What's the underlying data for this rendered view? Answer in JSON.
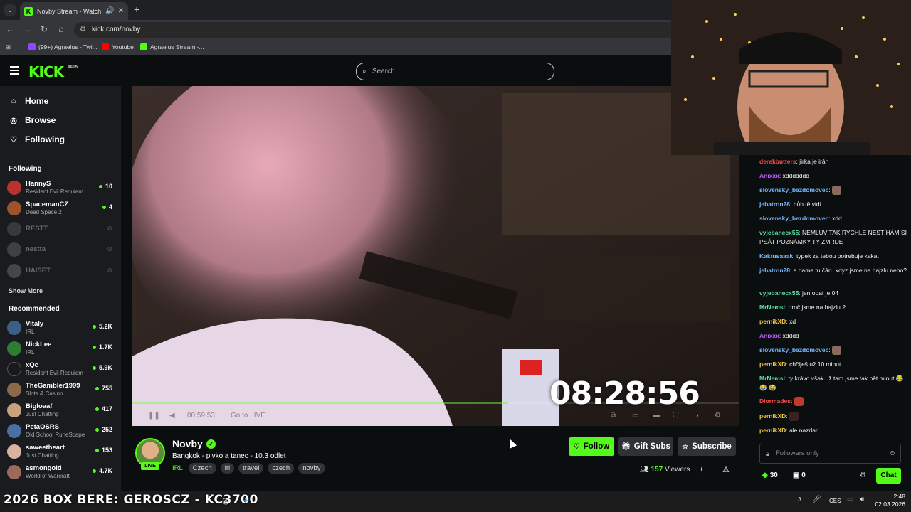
{
  "browser": {
    "tab_title": "Novby Stream - Watch Live",
    "url": "kick.com/novby",
    "bookmarks": [
      {
        "label": "(99+) Agraelus - Twi...",
        "icon": "twitch-icon",
        "color": "#9146ff"
      },
      {
        "label": "Youtube",
        "icon": "youtube-icon",
        "color": "#ff0000"
      },
      {
        "label": "Agraelus Stream -...",
        "icon": "kick-icon",
        "color": "#53fc18"
      }
    ]
  },
  "header": {
    "logo": "KICK",
    "logo_badge": "BETA",
    "search_placeholder": "Search"
  },
  "sidebar": {
    "nav": [
      {
        "label": "Home",
        "icon": "home-icon"
      },
      {
        "label": "Browse",
        "icon": "compass-icon"
      },
      {
        "label": "Following",
        "icon": "heart-icon"
      }
    ],
    "following_title": "Following",
    "following": [
      {
        "name": "HannyS",
        "category": "Resident Evil Requiem",
        "viewers": "10",
        "live": true
      },
      {
        "name": "SpacemanCZ",
        "category": "Dead Space 2",
        "viewers": "4",
        "live": true
      },
      {
        "name": "RESTT",
        "live": false
      },
      {
        "name": "nestta",
        "live": false
      },
      {
        "name": "HAISET",
        "live": false
      }
    ],
    "show_more": "Show More",
    "recommended_title": "Recommended",
    "recommended": [
      {
        "name": "Vitaly",
        "category": "IRL",
        "viewers": "5.2K"
      },
      {
        "name": "NickLee",
        "category": "IRL",
        "viewers": "1.7K"
      },
      {
        "name": "xQc",
        "category": "Resident Evil Requiem",
        "viewers": "5.9K"
      },
      {
        "name": "TheGambler1999",
        "category": "Slots & Casino",
        "viewers": "755"
      },
      {
        "name": "Bigloaaf",
        "category": "Just Chatting",
        "viewers": "417"
      },
      {
        "name": "PetaOSRS",
        "category": "Old School RuneScape",
        "viewers": "252"
      },
      {
        "name": "saweetheart",
        "category": "Just Chatting",
        "viewers": "153"
      },
      {
        "name": "asmongold",
        "category": "World of Warcraft",
        "viewers": "4.7K"
      }
    ]
  },
  "player": {
    "timer_overlay": "08:28:56",
    "elapsed": "00:59:53",
    "go_live": "Go to LIVE"
  },
  "channel": {
    "name": "Novby",
    "live_badge": "LIVE",
    "title": "Bangkok - pivko a tanec - 10.3 odlet",
    "category": "IRL",
    "tags": [
      "Czech",
      "irl",
      "travel",
      "czech",
      "novby"
    ],
    "follow_label": "Follow",
    "gift_label": "Gift Subs",
    "subscribe_label": "Subscribe",
    "viewers_count": "157",
    "viewers_label": "Viewers"
  },
  "chat": {
    "messages": [
      {
        "user": "derekbutters",
        "color": "#ff4d4d",
        "text": "jirka je irán"
      },
      {
        "user": "Anixxx",
        "color": "#c15cff",
        "text": "xddddddd"
      },
      {
        "user": "slovensky_bezdomovec",
        "color": "#7ab8ff",
        "text": "",
        "emote": true
      },
      {
        "user": "jebatron28",
        "color": "#7ab8ff",
        "text": "bůh tě vidí"
      },
      {
        "user": "slovensky_bezdomovec",
        "color": "#7ab8ff",
        "text": "xdd"
      },
      {
        "user": "vyjebanecx55",
        "color": "#5ce0a8",
        "text": "NEMLUV TAK RYCHLE NESTÍHÁM SI PSÁT POZNÁMKY TY ZMRDE"
      },
      {
        "user": "Kaktusaaak",
        "color": "#7ab8ff",
        "text": "typek za tebou potrebuje kakat"
      },
      {
        "user": "jebatron28",
        "color": "#7ab8ff",
        "text": "a dame tu čáru kdyz jsme na hajzlu nebo?"
      },
      {
        "user": "vyjebanecx55",
        "color": "#5ce0a8",
        "text": "jen opat je 04"
      },
      {
        "user": "MrNemsi",
        "color": "#5ce0a8",
        "text": "proč jsme na hajzlu ?"
      },
      {
        "user": "pernikXD",
        "color": "#f5c842",
        "text": "xd"
      },
      {
        "user": "Anixxx",
        "color": "#c15cff",
        "text": "xdddd"
      },
      {
        "user": "slovensky_bezdomovec",
        "color": "#7ab8ff",
        "text": "",
        "emote": true
      },
      {
        "user": "pernikXD",
        "color": "#f5c842",
        "text": "chčiješ už 10 minut"
      },
      {
        "user": "MrNemsi",
        "color": "#5ce0a8",
        "text": "ty krávo však už tam jsme tak pět minut 😂 😂 😂"
      },
      {
        "user": "Diormades",
        "color": "#ff4d4d",
        "text": "",
        "emote": true
      },
      {
        "user": "pernikXD",
        "color": "#f5c842",
        "text": "",
        "emote": true
      },
      {
        "user": "pernikXD",
        "color": "#f5c842",
        "text": "ale nazdar"
      }
    ],
    "input_placeholder": "Followers only",
    "points": "30",
    "gifts": "0",
    "send_label": "Chat"
  },
  "taskbar": {
    "ticker": "2026 BOX BERE: GEROSCZ - KC3700",
    "lang": "CES",
    "time": "2:48",
    "date": "02.03.2026"
  }
}
